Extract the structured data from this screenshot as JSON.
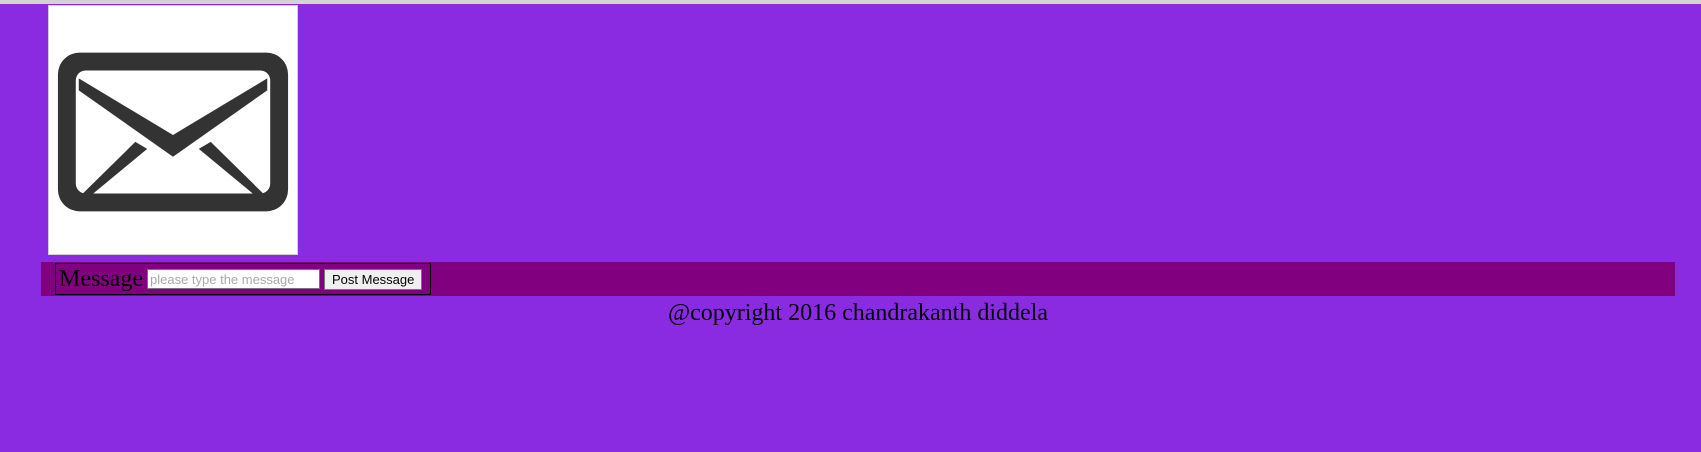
{
  "logo": {
    "icon": "envelope-icon"
  },
  "message_bar": {
    "label": "Message",
    "input_placeholder": "please type the message",
    "input_value": "",
    "button_label": "Post Message"
  },
  "footer": {
    "copyright": "@copyright 2016 chandrakanth diddela"
  },
  "colors": {
    "page_background": "#8a2be2",
    "message_bar_background": "#800080"
  }
}
